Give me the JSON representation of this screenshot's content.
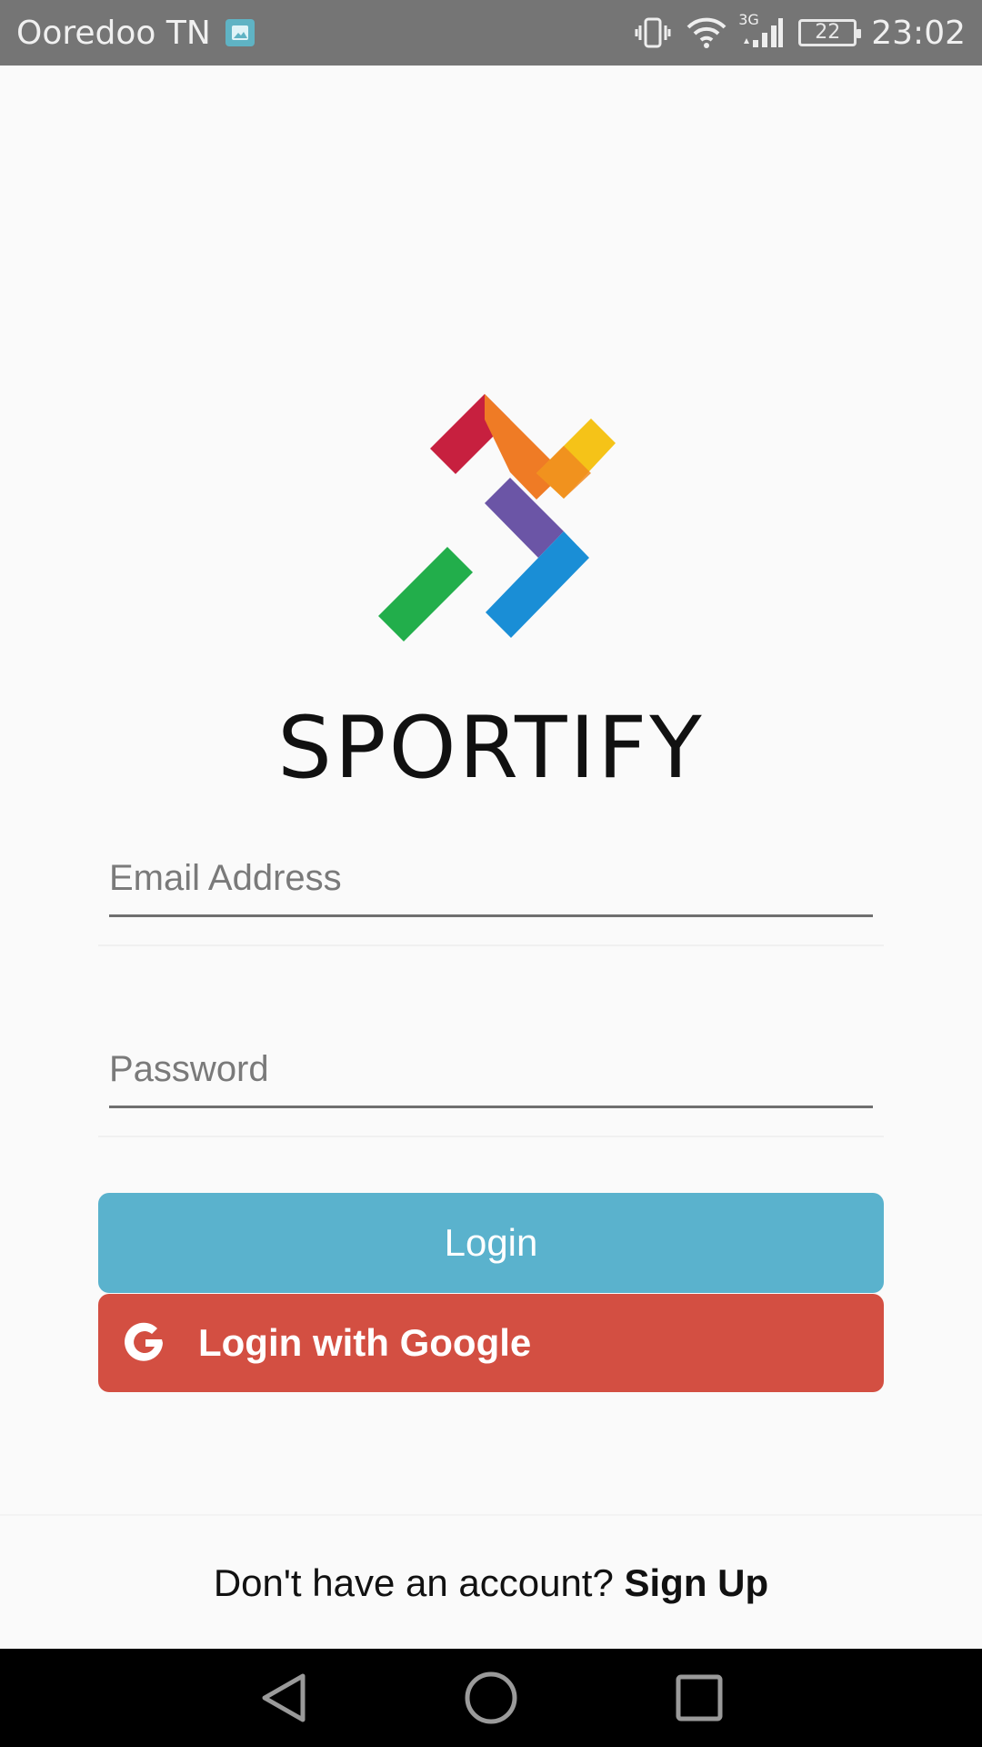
{
  "status_bar": {
    "carrier": "Ooredoo TN",
    "network": "3G",
    "battery": "22",
    "time": "23:02"
  },
  "brand": {
    "name": "SPORTIFY",
    "logo_colors": [
      "#c7203f",
      "#ef7b25",
      "#f5c318",
      "#6b55a6",
      "#1a8ed6",
      "#22ae4b"
    ]
  },
  "form": {
    "email_placeholder": "Email Address",
    "password_placeholder": "Password",
    "login_label": "Login",
    "google_label": "Login with Google"
  },
  "footer": {
    "prompt": "Don't have an account? ",
    "signup_label": "Sign Up"
  },
  "colors": {
    "login_button": "#5ab2cd",
    "google_button": "#d34f42",
    "status_bar": "#757575"
  }
}
